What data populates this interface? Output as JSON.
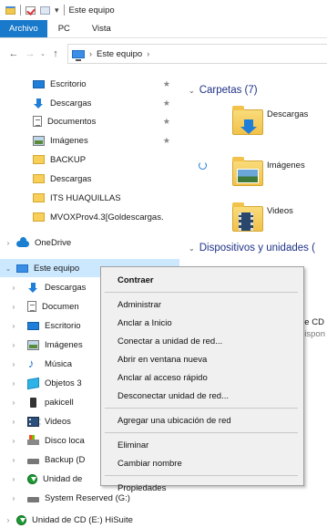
{
  "window": {
    "title": "Este equipo",
    "quick_access_pin": "▾"
  },
  "ribbon": {
    "tabs": [
      {
        "label": "Archivo",
        "active": true
      },
      {
        "label": "PC",
        "active": false
      },
      {
        "label": "Vista",
        "active": false
      }
    ]
  },
  "navigation": {
    "back": "←",
    "forward": "→",
    "history": "⌄",
    "up": "↑",
    "path_separator_1": "›",
    "path_label": "Este equipo",
    "path_separator_2": "›"
  },
  "nav_pane": {
    "quick_access": [
      {
        "label": "Escritorio",
        "icon": "desktop-icon",
        "pinned": true
      },
      {
        "label": "Descargas",
        "icon": "download-icon",
        "pinned": true
      },
      {
        "label": "Documentos",
        "icon": "document-icon",
        "pinned": true
      },
      {
        "label": "Imágenes",
        "icon": "pictures-icon",
        "pinned": true
      },
      {
        "label": "BACKUP",
        "icon": "folder-icon",
        "pinned": false
      },
      {
        "label": "Descargas",
        "icon": "folder-icon",
        "pinned": false
      },
      {
        "label": "ITS HUAQUILLAS",
        "icon": "folder-icon",
        "pinned": false
      },
      {
        "label": "MVOXProv4.3[Goldescargas.",
        "icon": "folder-icon",
        "pinned": false
      }
    ],
    "pin_glyph": "★",
    "onedrive": "OneDrive",
    "this_pc": "Este equipo",
    "pc_children": [
      {
        "label": "Descargas",
        "icon": "download-icon"
      },
      {
        "label": "Documen",
        "icon": "document-icon"
      },
      {
        "label": "Escritorio",
        "icon": "desktop-icon"
      },
      {
        "label": "Imágenes",
        "icon": "pictures-icon"
      },
      {
        "label": "Música",
        "icon": "music-icon"
      },
      {
        "label": "Objetos 3",
        "icon": "3d-objects-icon"
      },
      {
        "label": "pakicell",
        "icon": "phone-icon"
      },
      {
        "label": "Videos",
        "icon": "video-icon"
      },
      {
        "label": "Disco loca",
        "icon": "windows-drive-icon"
      },
      {
        "label": "Backup (D",
        "icon": "drive-icon"
      },
      {
        "label": "Unidad de",
        "icon": "cd-drive-icon"
      },
      {
        "label": "System Reserved (G:)",
        "icon": "drive-icon"
      }
    ],
    "cd_drive": "Unidad de CD (E:) HiSuite"
  },
  "content": {
    "folders_header": "Carpetas (7)",
    "folders": [
      {
        "label": "Descargas",
        "icon": "downloads-folder-icon"
      },
      {
        "label": "Imágenes",
        "icon": "pictures-folder-icon"
      },
      {
        "label": "Videos",
        "icon": "videos-folder-icon"
      }
    ],
    "devices_header": "Dispositivos y unidades (",
    "device_partial_label": "de CD",
    "device_partial_sub": "dispon"
  },
  "context_menu": {
    "items": [
      {
        "type": "item",
        "label": "Contraer",
        "bold": true
      },
      {
        "type": "sep"
      },
      {
        "type": "item",
        "label": "Administrar"
      },
      {
        "type": "item",
        "label": "Anclar a Inicio"
      },
      {
        "type": "item",
        "label": "Conectar a unidad de red..."
      },
      {
        "type": "item",
        "label": "Abrir en ventana nueva"
      },
      {
        "type": "item",
        "label": "Anclar al acceso rápido"
      },
      {
        "type": "item",
        "label": "Desconectar unidad de red..."
      },
      {
        "type": "sep"
      },
      {
        "type": "item",
        "label": "Agregar una ubicación de red"
      },
      {
        "type": "sep"
      },
      {
        "type": "item",
        "label": "Eliminar"
      },
      {
        "type": "item",
        "label": "Cambiar nombre"
      },
      {
        "type": "sep"
      },
      {
        "type": "item",
        "label": "Propiedades"
      }
    ]
  },
  "colors": {
    "accent": "#1979ca",
    "selection": "#cce8ff",
    "group_header": "#1e3287"
  }
}
